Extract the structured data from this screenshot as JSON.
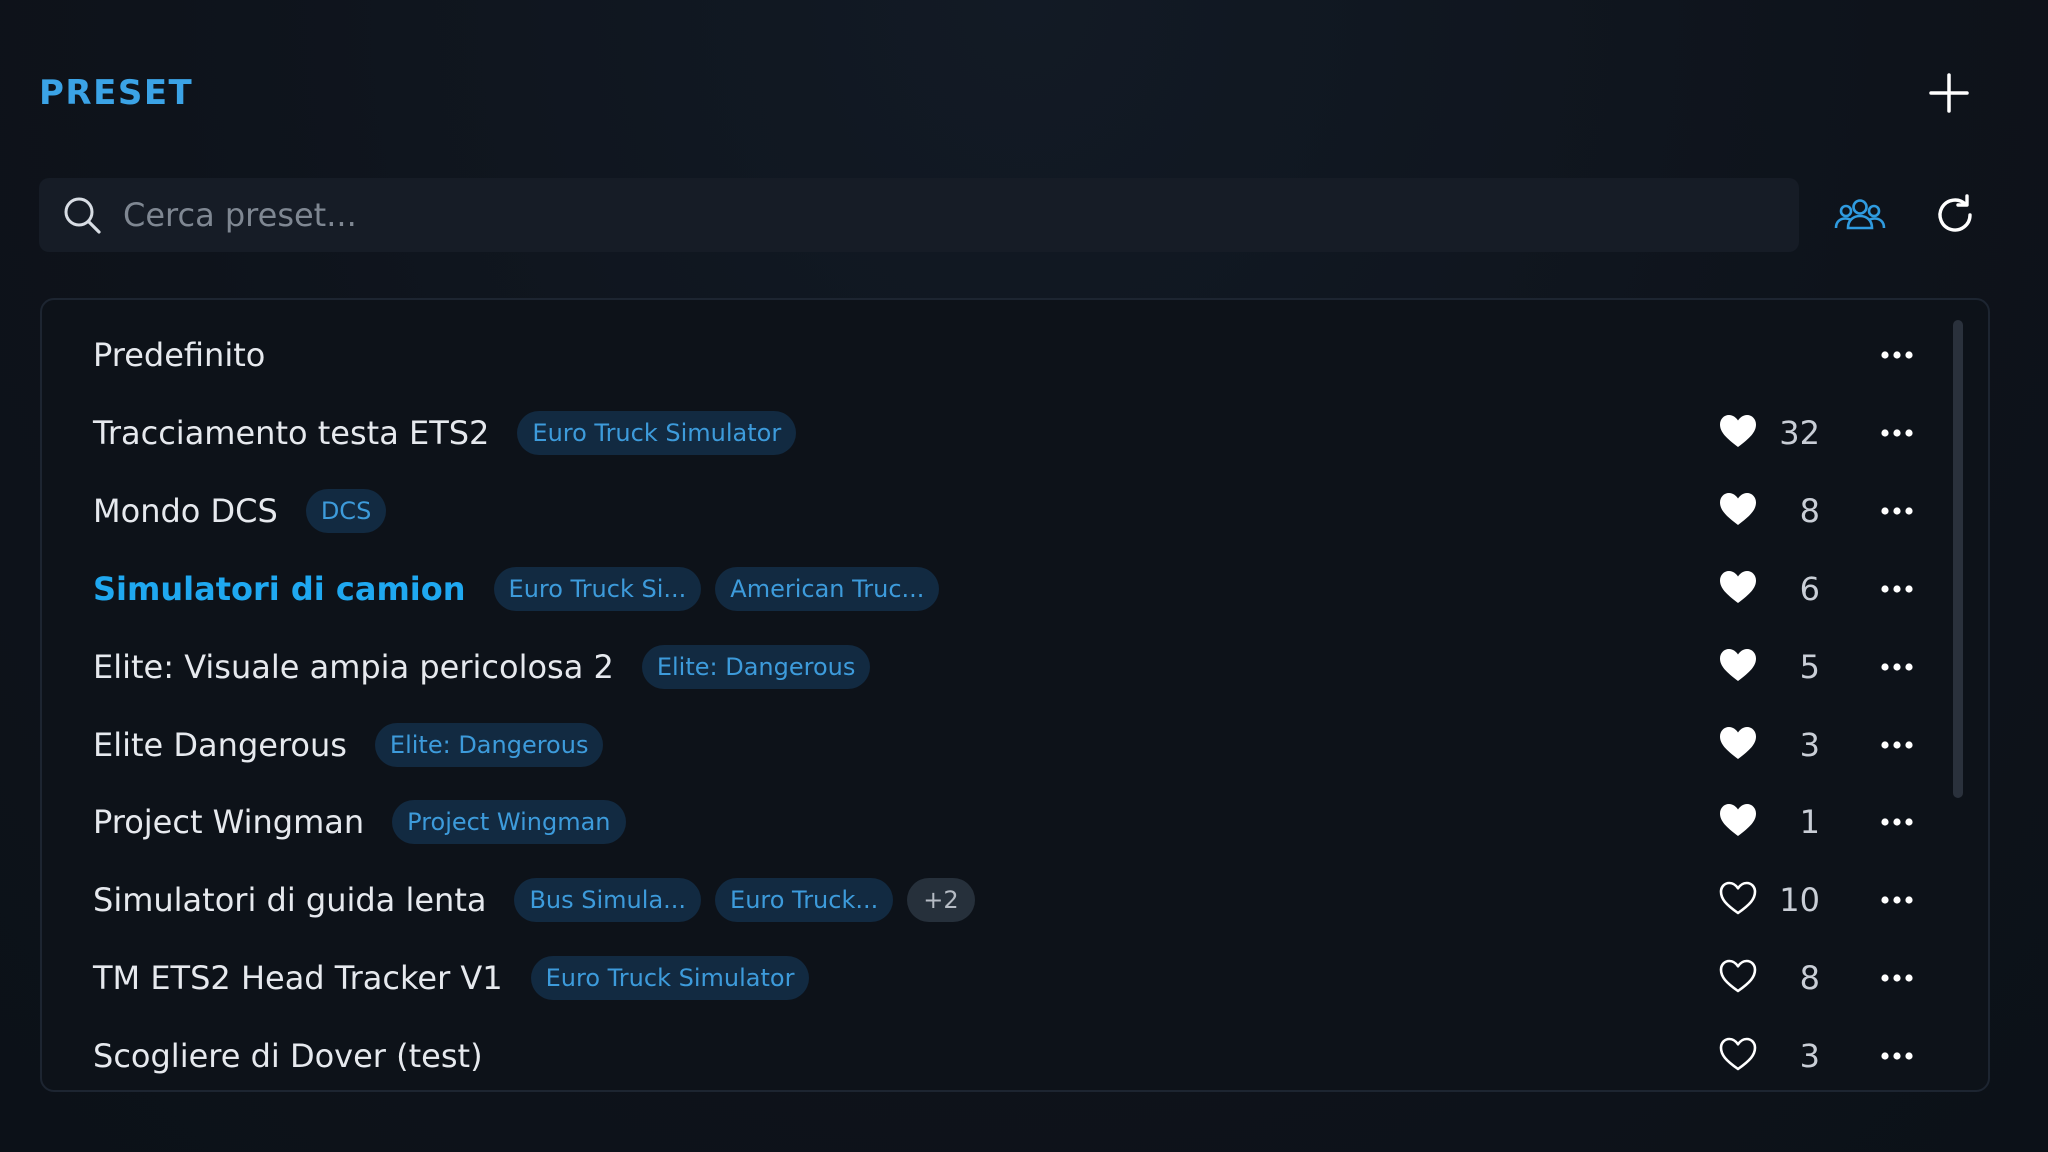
{
  "header": {
    "title": "PRESET",
    "add_icon": "plus-icon"
  },
  "search": {
    "placeholder": "Cerca preset...",
    "value": "",
    "icon": "search-icon"
  },
  "toolbar": {
    "community_icon": "users-group-icon",
    "refresh_icon": "refresh-icon"
  },
  "colors": {
    "accent": "#3ba3e6",
    "active_name": "#1fa8f0",
    "tag_bg": "#122a41",
    "tag_text": "#3d9bdb",
    "background": "#0e131b"
  },
  "presets": [
    {
      "name": "Predefinito",
      "tags": [],
      "more": "",
      "liked": null,
      "likes": "",
      "active": false
    },
    {
      "name": "Tracciamento testa ETS2",
      "tags": [
        "Euro Truck Simulator"
      ],
      "more": "",
      "liked": true,
      "likes": "32",
      "active": false
    },
    {
      "name": "Mondo DCS",
      "tags": [
        "DCS"
      ],
      "more": "",
      "liked": true,
      "likes": "8",
      "active": false
    },
    {
      "name": "Simulatori di camion",
      "tags": [
        "Euro Truck Si...",
        "American Truc..."
      ],
      "more": "",
      "liked": true,
      "likes": "6",
      "active": true
    },
    {
      "name": "Elite: Visuale ampia pericolosa 2",
      "tags": [
        "Elite: Dangerous"
      ],
      "more": "",
      "liked": true,
      "likes": "5",
      "active": false
    },
    {
      "name": "Elite Dangerous",
      "tags": [
        "Elite: Dangerous"
      ],
      "more": "",
      "liked": true,
      "likes": "3",
      "active": false
    },
    {
      "name": "Project Wingman",
      "tags": [
        "Project Wingman"
      ],
      "more": "",
      "liked": true,
      "likes": "1",
      "active": false
    },
    {
      "name": "Simulatori di guida lenta",
      "tags": [
        "Bus Simula...",
        "Euro Truck..."
      ],
      "more": "+2",
      "liked": false,
      "likes": "10",
      "active": false
    },
    {
      "name": "TM ETS2 Head Tracker V1",
      "tags": [
        "Euro Truck Simulator"
      ],
      "more": "",
      "liked": false,
      "likes": "8",
      "active": false
    },
    {
      "name": "Scogliere di Dover (test)",
      "tags": [],
      "more": "",
      "liked": false,
      "likes": "3",
      "active": false
    }
  ]
}
